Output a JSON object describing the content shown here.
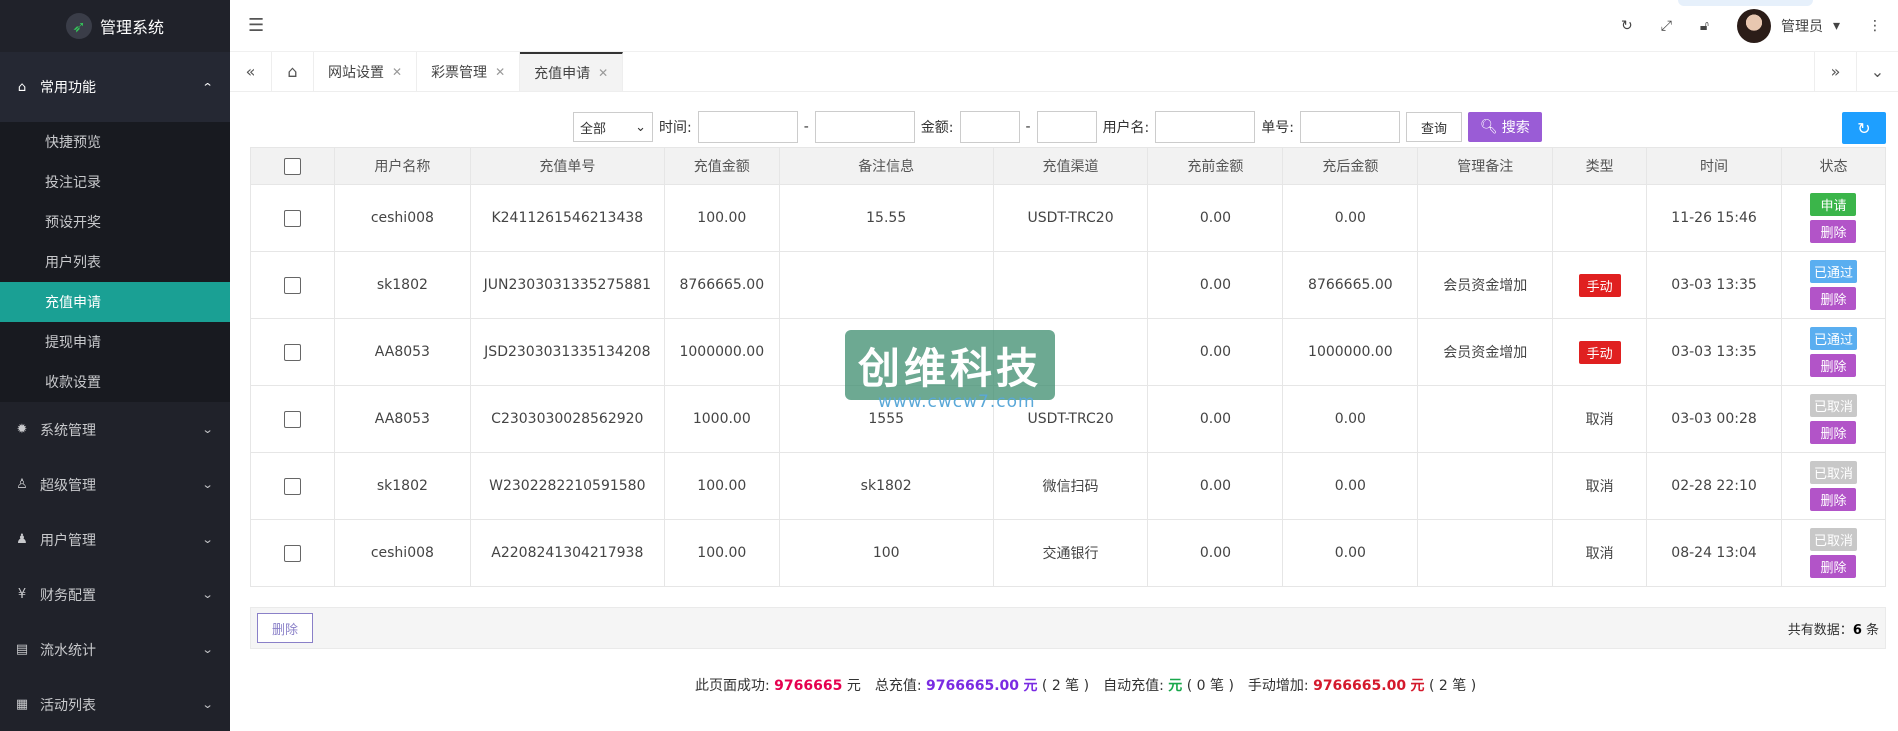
{
  "app": {
    "title": "管理系统"
  },
  "sidebar": {
    "group_open": {
      "label": "常用功能"
    },
    "sub_items": [
      {
        "label": "快捷预览"
      },
      {
        "label": "投注记录"
      },
      {
        "label": "预设开奖"
      },
      {
        "label": "用户列表"
      },
      {
        "label": "充值申请"
      },
      {
        "label": "提现申请"
      },
      {
        "label": "收款设置"
      }
    ],
    "menus": [
      {
        "label": "系统管理"
      },
      {
        "label": "超级管理"
      },
      {
        "label": "用户管理"
      },
      {
        "label": "财务配置"
      },
      {
        "label": "流水统计"
      },
      {
        "label": "活动列表"
      }
    ]
  },
  "header": {
    "user": "管理员"
  },
  "tabs": [
    {
      "label": "网站设置"
    },
    {
      "label": "彩票管理"
    },
    {
      "label": "充值申请"
    }
  ],
  "filter": {
    "select_value": "全部",
    "time_label": "时间:",
    "dash": "-",
    "amount_label": "金额:",
    "username_label": "用户名:",
    "order_label": "单号:",
    "query_btn": "查询",
    "search_btn": "搜索"
  },
  "table": {
    "headers": [
      "用户名称",
      "充值单号",
      "充值金额",
      "备注信息",
      "充值渠道",
      "充前金额",
      "充后金额",
      "管理备注",
      "类型",
      "时间",
      "状态"
    ],
    "rows": [
      {
        "user": "ceshi008",
        "order": "K2411261546213438",
        "amount": "100.00",
        "remark": "15.55",
        "channel": "USDT-TRC20",
        "before": "0.00",
        "after": "0.00",
        "admin_note": "",
        "type": "",
        "time": "11-26 15:46",
        "status": "申请",
        "del": "删除"
      },
      {
        "user": "sk1802",
        "order": "JUN2303031335275881",
        "amount": "8766665.00",
        "remark": "",
        "channel": "",
        "before": "0.00",
        "after": "8766665.00",
        "admin_note": "会员资金增加",
        "type": "手动",
        "time": "03-03 13:35",
        "status": "已通过",
        "del": "删除"
      },
      {
        "user": "AA8053",
        "order": "JSD2303031335134208",
        "amount": "1000000.00",
        "remark": "",
        "channel": "",
        "before": "0.00",
        "after": "1000000.00",
        "admin_note": "会员资金增加",
        "type": "手动",
        "time": "03-03 13:35",
        "status": "已通过",
        "del": "删除"
      },
      {
        "user": "AA8053",
        "order": "C2303030028562920",
        "amount": "1000.00",
        "remark": "1555",
        "channel": "USDT-TRC20",
        "before": "0.00",
        "after": "0.00",
        "admin_note": "",
        "type": "取消",
        "time": "03-03 00:28",
        "status": "已取消",
        "del": "删除"
      },
      {
        "user": "sk1802",
        "order": "W2302282210591580",
        "amount": "100.00",
        "remark": "sk1802",
        "channel": "微信扫码",
        "before": "0.00",
        "after": "0.00",
        "admin_note": "",
        "type": "取消",
        "time": "02-28 22:10",
        "status": "已取消",
        "del": "删除"
      },
      {
        "user": "ceshi008",
        "order": "A2208241304217938",
        "amount": "100.00",
        "remark": "100",
        "channel": "交通银行",
        "before": "0.00",
        "after": "0.00",
        "admin_note": "",
        "type": "取消",
        "time": "08-24 13:04",
        "status": "已取消",
        "del": "删除"
      }
    ]
  },
  "bottom": {
    "delete_btn": "删除",
    "total_prefix": "共有数据：",
    "total_count": "6",
    "total_suffix": " 条"
  },
  "summary": {
    "page_success_label": "此页面成功:",
    "page_success_value": "9766665",
    "yuan": "元",
    "total_label": "总充值:",
    "total_value": "9766665.00",
    "total_count": "( 2 笔 )",
    "auto_label": "自动充值:",
    "auto_value": "",
    "auto_count": "( 0 笔 )",
    "manual_label": "手动增加:",
    "manual_value": "9766665.00",
    "manual_count": "( 2 笔 )"
  },
  "watermark": {
    "text": "创维科技",
    "url": "www.cwcw7.com"
  },
  "colors": {
    "sidebar_bg": "#20222a",
    "active_teal": "#1aa094",
    "search_purple": "#9a5cd6",
    "refresh_blue": "#1e9fff"
  }
}
